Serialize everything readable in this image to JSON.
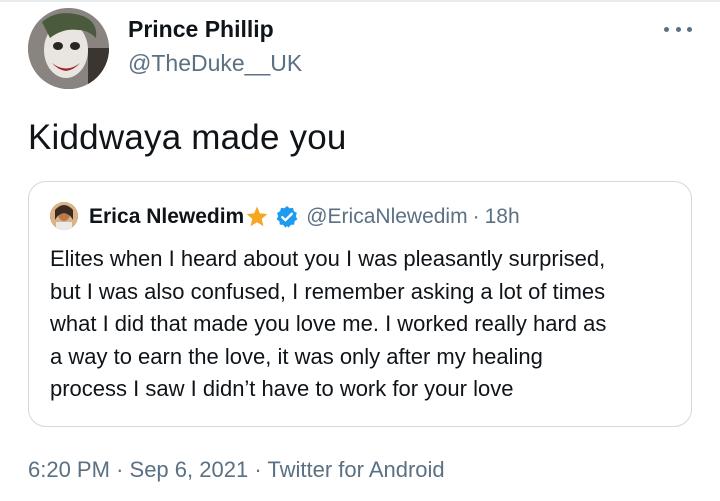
{
  "tweet": {
    "author_name": "Prince Phillip",
    "author_handle": "@TheDuke__UK",
    "text": "Kiddwaya made you",
    "time": "6:20 PM",
    "separator": "·",
    "date": "Sep 6, 2021",
    "source": "Twitter for Android"
  },
  "quoted_tweet": {
    "author_name": "Erica Nlewedim",
    "author_handle": "@EricaNlewedim",
    "separator": "·",
    "time": "18h",
    "lines": [
      "Elites when I heard about you I was pleasantly surprised,",
      "but I was also confused, I remember asking a lot of times",
      "what I did that made you love me. I worked really hard as",
      "a way to earn the love, it was only after my healing",
      "process I saw I didn’t have to work for your love"
    ]
  },
  "icons": {
    "more": "more-horizontal-icon",
    "star": "star-icon",
    "verified": "verified-badge-icon"
  },
  "colors": {
    "text_primary": "#0f1419",
    "text_secondary": "#5b7083",
    "border": "#cfd9de",
    "verified_blue": "#1d9bf0",
    "star": "#f5a623"
  }
}
